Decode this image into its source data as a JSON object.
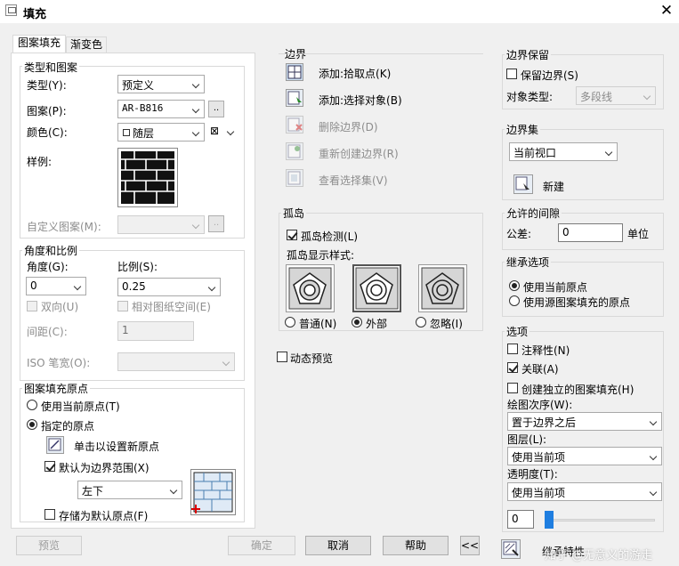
{
  "window": {
    "title": "填充",
    "close_label": "✕"
  },
  "tabs": [
    {
      "label": "图案填充"
    },
    {
      "label": "渐变色"
    }
  ],
  "type_pattern": {
    "group_label": "类型和图案",
    "type_label": "类型(Y):",
    "type_value": "预定义",
    "pattern_label": "图案(P):",
    "pattern_value": "AR-B816",
    "color_label": "颜色(C):",
    "color_value": "随层",
    "color2_value": "⊠",
    "swatch_label": "样例:",
    "custom_label": "自定义图案(M):",
    "ellipsis": ".."
  },
  "angle_scale": {
    "group_label": "角度和比例",
    "angle_label": "角度(G):",
    "angle_value": "0",
    "scale_label": "比例(S):",
    "scale_value": "0.25",
    "double_label": "双向(U)",
    "relative_label": "相对图纸空间(E)",
    "spacing_label": "间距(C):",
    "spacing_value": "1",
    "iso_label": "ISO 笔宽(O):"
  },
  "origin": {
    "group_label": "图案填充原点",
    "use_current_label": "使用当前原点(T)",
    "specified_label": "指定的原点",
    "click_label": "单击以设置新原点",
    "default_extent_label": "默认为边界范围(X)",
    "position_value": "左下",
    "store_label": "存储为默认原点(F)"
  },
  "boundary": {
    "group_label": "边界",
    "add_pick_label": "添加:拾取点(K)",
    "add_select_label": "添加:选择对象(B)",
    "remove_label": "删除边界(D)",
    "recreate_label": "重新创建边界(R)",
    "view_label": "查看选择集(V)"
  },
  "islands": {
    "group_label": "孤岛",
    "detect_label": "孤岛检测(L)",
    "style_label": "孤岛显示样式:",
    "normal_label": "普通(N)",
    "outer_label": "外部",
    "ignore_label": "忽略(I)"
  },
  "preview_anim_label": "动态预览",
  "retain": {
    "group_label": "边界保留",
    "keep_label": "保留边界(S)",
    "object_type_label": "对象类型:",
    "object_type_value": "多段线"
  },
  "boundary_set": {
    "group_label": "边界集",
    "value": "当前视口",
    "new_label": "新建"
  },
  "gap": {
    "group_label": "允许的间隙",
    "tolerance_label": "公差:",
    "tolerance_value": "0",
    "unit_label": "单位"
  },
  "inherit": {
    "group_label": "继承选项",
    "use_current_label": "使用当前原点",
    "use_source_label": "使用源图案填充的原点"
  },
  "options": {
    "group_label": "选项",
    "annotative_label": "注释性(N)",
    "associative_label": "关联(A)",
    "separate_label": "创建独立的图案填充(H)",
    "draw_order_label": "绘图次序(W):",
    "draw_order_value": "置于边界之后",
    "layer_label": "图层(L):",
    "layer_value": "使用当前项",
    "transparency_label": "透明度(T):",
    "transparency_value": "使用当前项",
    "transparency_number": "0"
  },
  "footer": {
    "preview_label": "预览",
    "ok_label": "确定",
    "cancel_label": "取消",
    "help_label": "帮助",
    "collapse_label": "<<",
    "inherit_label": "继承特性",
    "watermark": "知乎 @无意义的游走"
  }
}
